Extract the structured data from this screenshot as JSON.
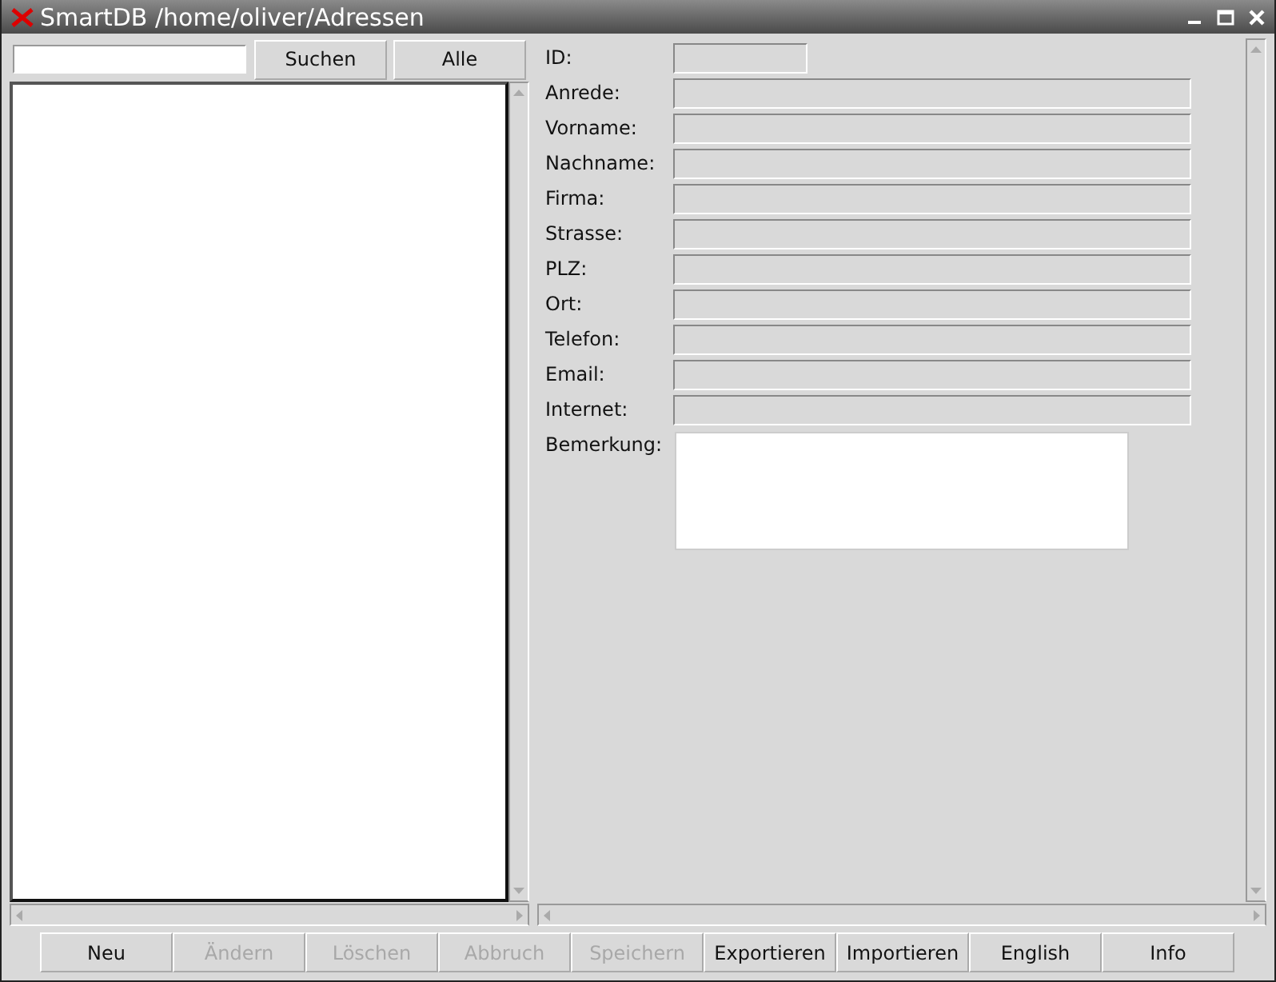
{
  "window": {
    "title": "SmartDB /home/oliver/Adressen"
  },
  "search": {
    "buttons": [
      {
        "label": "Suchen",
        "disabled": false
      },
      {
        "label": "Alle",
        "disabled": false
      }
    ]
  },
  "form": {
    "fields": [
      {
        "label": "ID:",
        "kind": "short",
        "disabled": true
      },
      {
        "label": "Anrede:",
        "kind": "line",
        "disabled": true
      },
      {
        "label": "Vorname:",
        "kind": "line",
        "disabled": true
      },
      {
        "label": "Nachname:",
        "kind": "line",
        "disabled": true
      },
      {
        "label": "Firma:",
        "kind": "line",
        "disabled": true
      },
      {
        "label": "Strasse:",
        "kind": "line",
        "disabled": true
      },
      {
        "label": "PLZ:",
        "kind": "line",
        "disabled": true
      },
      {
        "label": "Ort:",
        "kind": "line",
        "disabled": true
      },
      {
        "label": "Telefon:",
        "kind": "line",
        "disabled": true
      },
      {
        "label": "Email:",
        "kind": "line",
        "disabled": true
      },
      {
        "label": "Internet:",
        "kind": "line",
        "disabled": true
      },
      {
        "label": "Bemerkung:",
        "kind": "area",
        "disabled": false
      }
    ]
  },
  "buttons": [
    {
      "label": "Neu",
      "disabled": false
    },
    {
      "label": "Ändern",
      "disabled": true
    },
    {
      "label": "Löschen",
      "disabled": true
    },
    {
      "label": "Abbruch",
      "disabled": true
    },
    {
      "label": "Speichern",
      "disabled": true
    },
    {
      "label": "Exportieren",
      "disabled": false
    },
    {
      "label": "Importieren",
      "disabled": false
    },
    {
      "label": "English",
      "disabled": false
    },
    {
      "label": "Info",
      "disabled": false
    }
  ]
}
